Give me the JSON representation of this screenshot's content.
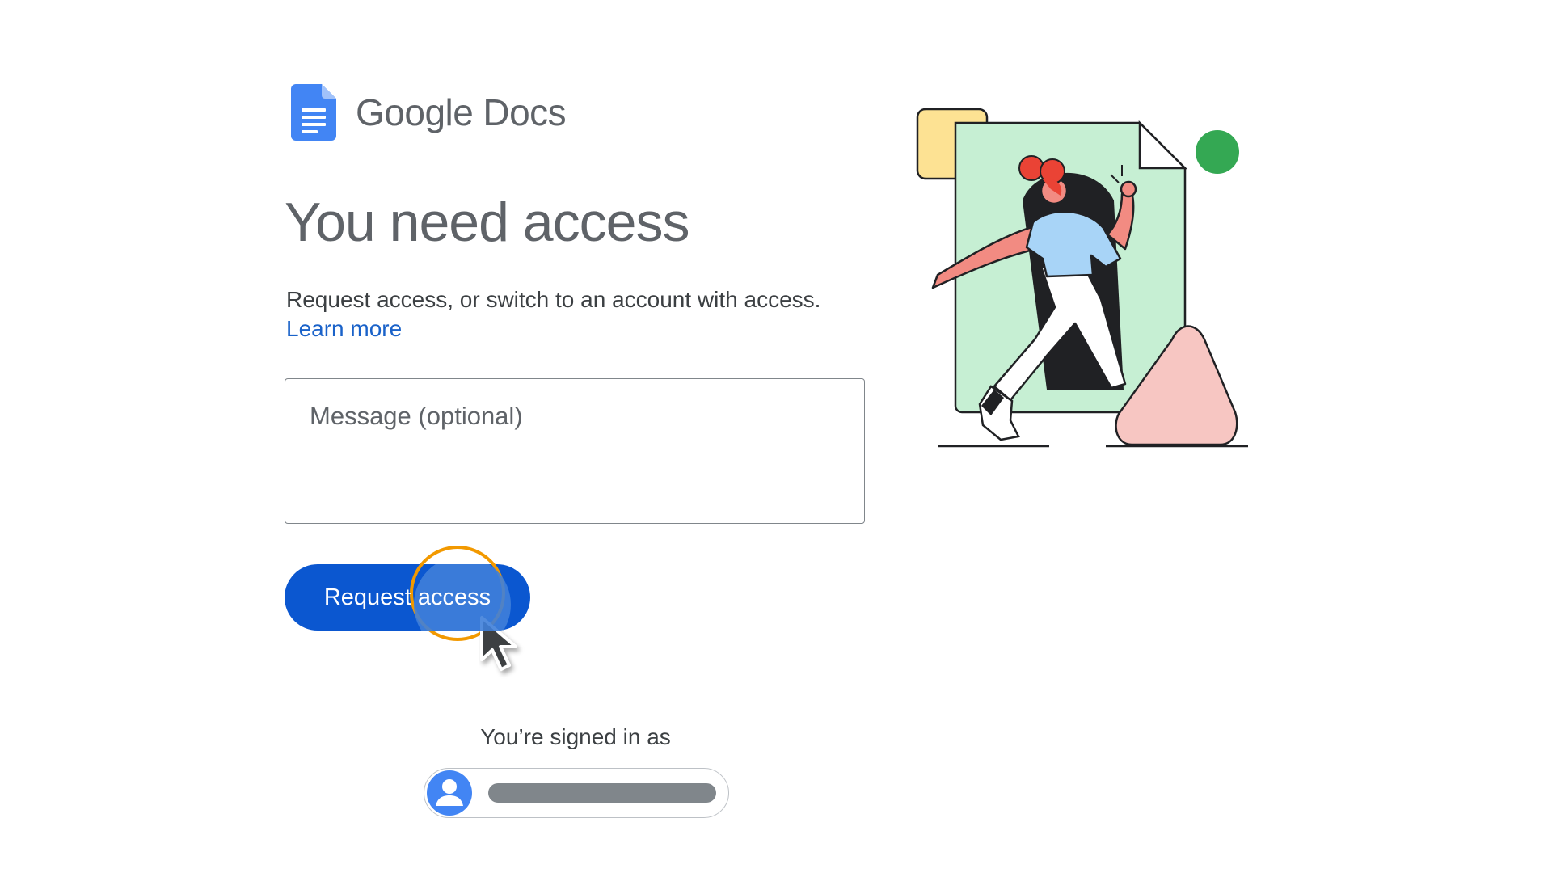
{
  "app": {
    "brand_google": "Google",
    "brand_product": "Docs",
    "logo_icon": "google-docs-icon",
    "accent_color": "#0b57d0",
    "focus_ring_color": "#f29900"
  },
  "main": {
    "title": "You need access",
    "subtitle": "Request access, or switch to an account with access.",
    "learn_more_label": "Learn more",
    "message_placeholder": "Message (optional)",
    "message_value": "",
    "request_button_label": "Request access"
  },
  "account": {
    "signed_in_label": "You’re signed in as",
    "avatar_icon": "person-icon"
  },
  "illustration": {
    "description_icon": "person-walking-through-document-illustration",
    "colors": {
      "document_green": "#c6efd3",
      "yellow_square": "#fde293",
      "green_circle": "#34a853",
      "pink_triangle": "#f7c6c2",
      "shirt_blue": "#a8d4f7",
      "hair_red": "#ea4335"
    }
  }
}
